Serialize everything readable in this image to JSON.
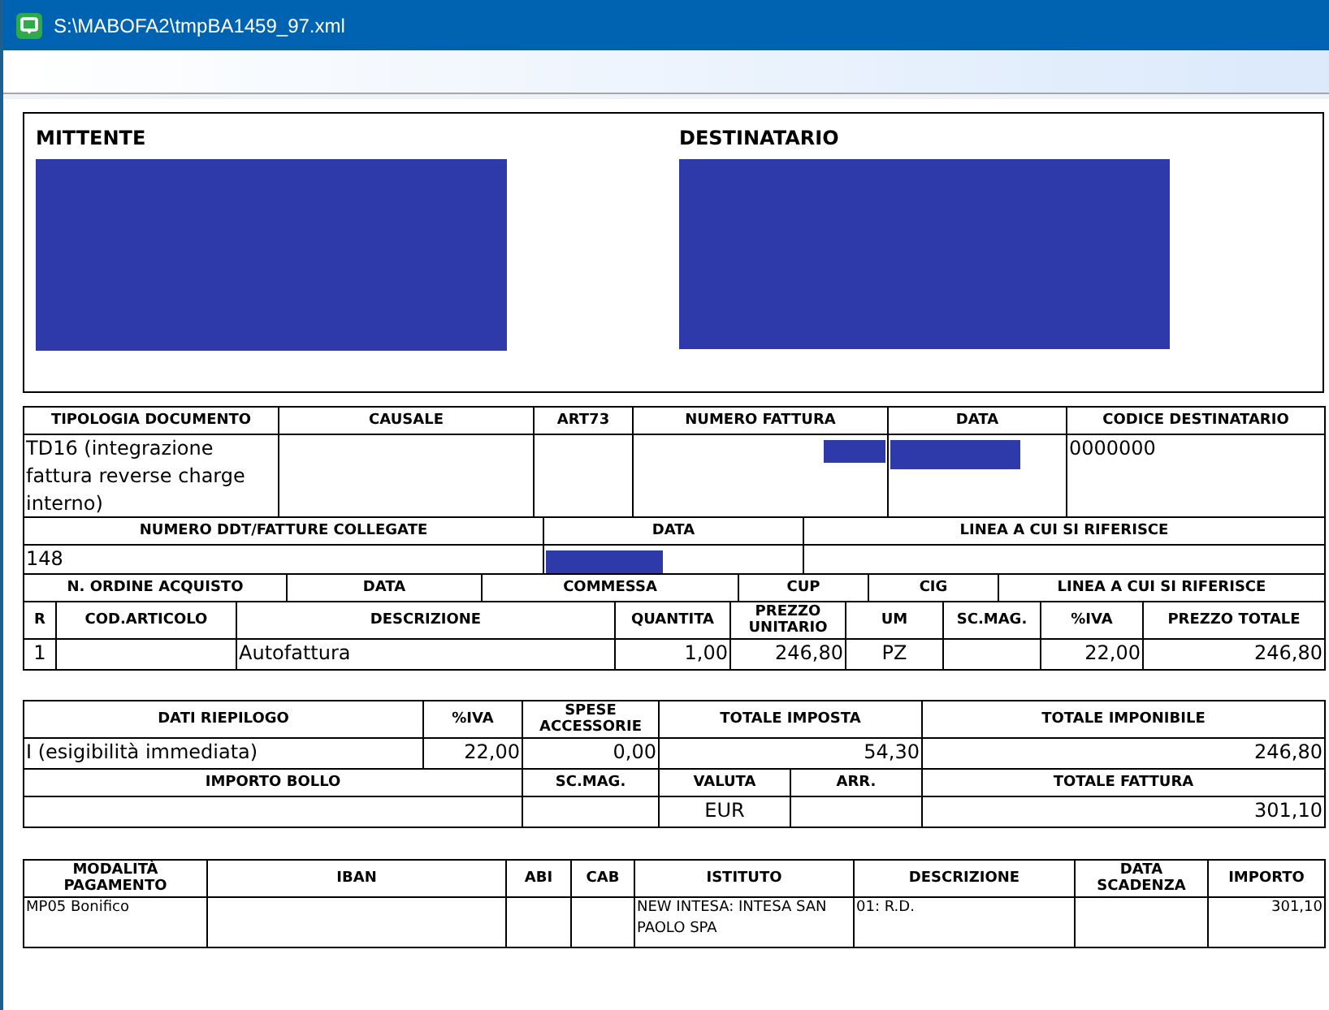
{
  "window": {
    "title": "S:\\MABOFA2\\tmpBA1459_97.xml"
  },
  "parties": [
    {
      "label": "MITTENTE",
      "redacted": true
    },
    {
      "label": "DESTINATARIO",
      "redacted": true
    }
  ],
  "document_table": {
    "columns": [
      "TIPOLOGIA DOCUMENTO",
      "CAUSALE",
      "ART73",
      "NUMERO FATTURA",
      "DATA",
      "CODICE DESTINATARIO"
    ],
    "values": {
      "tipologia_documento": "TD16 (integrazione fattura reverse charge interno)",
      "numero_fattura": {
        "redacted": true
      },
      "data": {
        "redacted": true
      },
      "codice_destinatario": "0000000"
    }
  },
  "linked_documents": {
    "columns": [
      "NUMERO DDT/FATTURE COLLEGATE",
      "DATA",
      "LINEA A CUI SI RIFERISCE"
    ],
    "values": {
      "numero": "148",
      "data": {
        "redacted": true
      }
    }
  },
  "order_table": {
    "columns": [
      "N. ORDINE ACQUISTO",
      "DATA",
      "COMMESSA",
      "CUP",
      "CIG",
      "LINEA A CUI SI RIFERISCE"
    ]
  },
  "lines": {
    "columns": [
      "R",
      "COD.ARTICOLO",
      "DESCRIZIONE",
      "QUANTITA",
      "PREZZO UNITARIO",
      "UM",
      "SC.MAG.",
      "%IVA",
      "PREZZO TOTALE"
    ],
    "rows": [
      {
        "r": "1",
        "descrizione": "Autofattura",
        "quantita": "1,00",
        "prezzo_unitario": "246,80",
        "um": "PZ",
        "iva": "22,00",
        "prezzo_totale": "246,80"
      }
    ]
  },
  "summary": {
    "columns": [
      "DATI RIEPILOGO",
      "%IVA",
      "SPESE ACCESSORIE",
      "TOTALE IMPOSTA",
      "TOTALE IMPONIBILE"
    ],
    "values": {
      "dati_riepilogo": "I (esigibilità immediata)",
      "iva": "22,00",
      "spese_accessorie": "0,00",
      "totale_imposta": "54,30",
      "totale_imponibile": "246,80"
    }
  },
  "totals": {
    "columns": [
      "IMPORTO BOLLO",
      "SC.MAG.",
      "VALUTA",
      "ARR.",
      "TOTALE FATTURA"
    ],
    "values": {
      "valuta": "EUR",
      "totale_fattura": "301,10"
    }
  },
  "payment": {
    "columns": [
      "MODALITÀ PAGAMENTO",
      "IBAN",
      "ABI",
      "CAB",
      "ISTITUTO",
      "DESCRIZIONE",
      "DATA SCADENZA",
      "IMPORTO"
    ],
    "values": {
      "modalita_pagamento": "MP05 Bonifico",
      "istituto": "NEW INTESA: INTESA SAN PAOLO SPA",
      "descrizione": "01: R.D.",
      "importo": "301,10"
    }
  }
}
